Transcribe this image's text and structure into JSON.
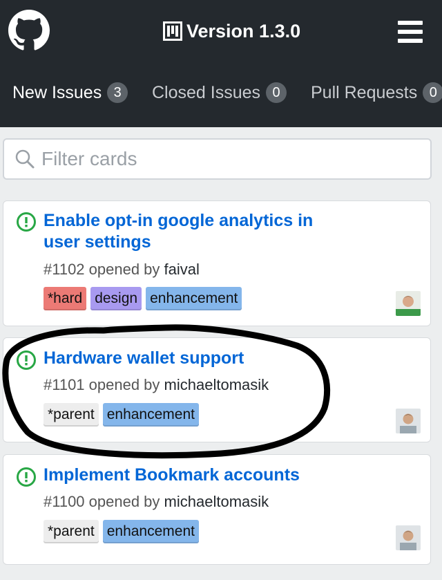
{
  "header": {
    "logo_icon": "github-octocat-icon",
    "project_icon": "project-board-icon",
    "version_title": "Version 1.3.0",
    "menu_icon": "hamburger-menu-icon",
    "background": "#24292e"
  },
  "tabs": [
    {
      "label": "New Issues",
      "count": "3",
      "active": true
    },
    {
      "label": "Closed Issues",
      "count": "0",
      "active": false
    },
    {
      "label": "Pull Requests",
      "count": "0",
      "active": false
    }
  ],
  "filter": {
    "placeholder": "Filter cards",
    "icon": "search-icon"
  },
  "cards": [
    {
      "title": "Enable opt-in google analytics in user settings",
      "number_text": "#1102 opened by",
      "author": "faival",
      "labels": [
        {
          "text": "*hard",
          "color": "#ec7a75"
        },
        {
          "text": "design",
          "color": "#a89af0"
        },
        {
          "text": "enhancement",
          "color": "#84b6eb"
        }
      ],
      "status_color": "#28a745"
    },
    {
      "title": "Hardware wallet support",
      "number_text": "#1101 opened by",
      "author": "michaeltomasik",
      "labels": [
        {
          "text": "*parent",
          "color": "#ededed"
        },
        {
          "text": "enhancement",
          "color": "#84b6eb"
        }
      ],
      "status_color": "#28a745"
    },
    {
      "title": "Implement Bookmark accounts",
      "number_text": "#1100 opened by",
      "author": "michaeltomasik",
      "labels": [
        {
          "text": "*parent",
          "color": "#ededed"
        },
        {
          "text": "enhancement",
          "color": "#84b6eb"
        }
      ],
      "status_color": "#28a745"
    }
  ],
  "colors": {
    "link": "#0366d6",
    "open_issue": "#28a745",
    "annotation_ink": "#000000"
  }
}
